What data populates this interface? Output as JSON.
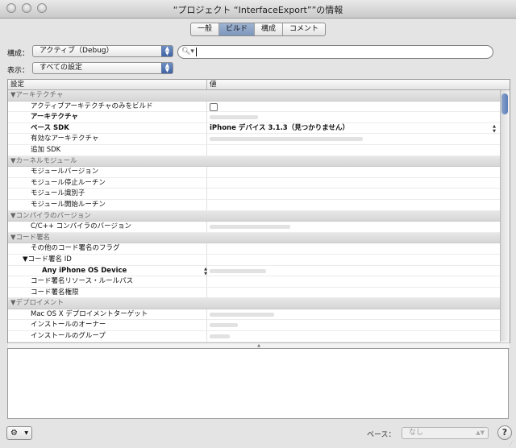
{
  "window": {
    "title": "“プロジェクト “InterfaceExport””の情報"
  },
  "tabs": [
    {
      "label": "一般",
      "active": false
    },
    {
      "label": "ビルド",
      "active": true
    },
    {
      "label": "構成",
      "active": false
    },
    {
      "label": "コメント",
      "active": false
    }
  ],
  "config": {
    "label": "構成：",
    "value": "アクティブ（Debug）"
  },
  "show": {
    "label": "表示：",
    "value": "すべての設定"
  },
  "search": {
    "value": "",
    "placeholder": ""
  },
  "table": {
    "col_setting": "設定",
    "col_value": "値",
    "rows": [
      {
        "type": "group",
        "name": "▼アーキテクチャ"
      },
      {
        "type": "item",
        "name": "アクティブアーキテクチャのみをビルド",
        "value_kind": "checkbox"
      },
      {
        "type": "item",
        "name": "アーキテクチャ",
        "bold": true,
        "value_kind": "blur",
        "blur_w": 60
      },
      {
        "type": "item",
        "name": "ベース SDK",
        "bold": true,
        "value": "iPhone デバイス 3.1.3（見つかりません）",
        "value_bold": true,
        "stepper": true
      },
      {
        "type": "item",
        "name": "有効なアーキテクチャ",
        "value_kind": "blur",
        "blur_w": 190
      },
      {
        "type": "item",
        "name": "追加 SDK"
      },
      {
        "type": "group",
        "name": "▼カーネルモジュール"
      },
      {
        "type": "item",
        "name": "モジュールバージョン"
      },
      {
        "type": "item",
        "name": "モジュール停止ルーチン"
      },
      {
        "type": "item",
        "name": "モジュール識別子"
      },
      {
        "type": "item",
        "name": "モジュール開始ルーチン"
      },
      {
        "type": "group",
        "name": "▼コンパイラのバージョン"
      },
      {
        "type": "item",
        "name": "C/C++ コンパイラのバージョン",
        "value_kind": "blur",
        "blur_w": 100
      },
      {
        "type": "group",
        "name": "▼コード署名"
      },
      {
        "type": "item",
        "name": "その他のコード署名のフラグ"
      },
      {
        "type": "item",
        "name": "▼コード署名 ID",
        "indent": "sub"
      },
      {
        "type": "item",
        "name": "Any iPhone OS Device",
        "bold": true,
        "indent": "deep",
        "value_kind": "blur",
        "blur_w": 70,
        "left_stepper": true
      },
      {
        "type": "item",
        "name": "コード署名リソース・ルールパス"
      },
      {
        "type": "item",
        "name": "コード署名権限"
      },
      {
        "type": "group",
        "name": "▼デプロイメント"
      },
      {
        "type": "item",
        "name": "Mac OS X デプロイメントターゲット",
        "value_kind": "blur",
        "blur_w": 80
      },
      {
        "type": "item",
        "name": "インストールのオーナー",
        "value_kind": "blur",
        "blur_w": 35
      },
      {
        "type": "item",
        "name": "インストールのグループ",
        "value_kind": "blur",
        "blur_w": 25
      }
    ]
  },
  "footer": {
    "base_label": "ベース：",
    "base_value": "なし",
    "help": "?"
  },
  "icons": {
    "gear": "gear-icon",
    "search": "search-icon",
    "help": "help-icon"
  }
}
